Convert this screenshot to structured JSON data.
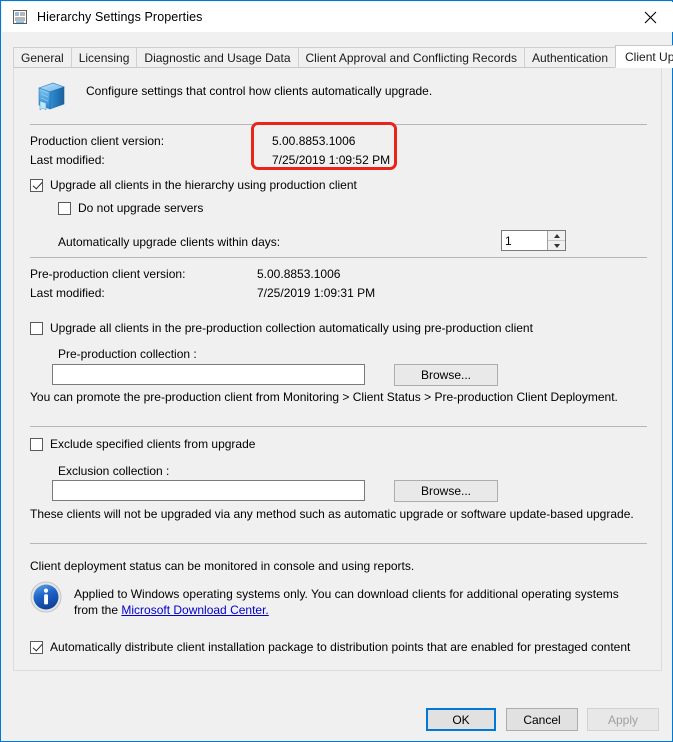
{
  "window": {
    "title": "Hierarchy Settings Properties",
    "title_icon": "properties-window-icon",
    "close_icon": "close-icon",
    "border_color": "#0078d7"
  },
  "tabs": [
    {
      "label": "General",
      "selected": false
    },
    {
      "label": "Licensing",
      "selected": false
    },
    {
      "label": "Diagnostic and Usage Data",
      "selected": false
    },
    {
      "label": "Client Approval and Conflicting Records",
      "selected": false
    },
    {
      "label": "Authentication",
      "selected": false
    },
    {
      "label": "Client Upgrade",
      "selected": true
    }
  ],
  "panel": {
    "header": {
      "icon": "client-package-3d-icon",
      "text": "Configure settings that control how clients automatically upgrade."
    },
    "production": {
      "version_label": "Production client version:",
      "version_value": "5.00.8853.1006",
      "modified_label": "Last modified:",
      "modified_value": "7/25/2019 1:09:52 PM",
      "upgrade_all_label": "Upgrade all clients in the hierarchy using production client",
      "upgrade_all_checked": true,
      "do_not_upgrade_servers_label": "Do not upgrade servers",
      "do_not_upgrade_servers_checked": false,
      "within_days_label": "Automatically upgrade clients within days:",
      "within_days_value": "1"
    },
    "preproduction": {
      "version_label": "Pre-production client version:",
      "version_value": "5.00.8853.1006",
      "modified_label": "Last modified:",
      "modified_value": "7/25/2019 1:09:31 PM",
      "upgrade_all_label": "Upgrade all clients in the pre-production collection automatically using pre-production client",
      "upgrade_all_checked": false,
      "collection_label": "Pre-production collection :",
      "collection_value": "",
      "collection_placeholder": "",
      "browse_label": "Browse...",
      "hint": "You can promote the pre-production client from Monitoring > Client Status > Pre-production Client Deployment."
    },
    "exclusion": {
      "exclude_label": "Exclude specified clients from upgrade",
      "exclude_checked": false,
      "collection_label": "Exclusion collection :",
      "collection_value": "",
      "collection_placeholder": "",
      "browse_label": "Browse...",
      "hint": "These clients will not be upgraded via any method such as automatic upgrade or software update-based upgrade."
    },
    "status": {
      "text": "Client deployment status can be monitored in console and using reports.",
      "info_icon": "info-icon",
      "info_text_before": "Applied to Windows operating systems only. You can download clients for additional operating systems from the ",
      "info_link": "Microsoft Download Center.",
      "auto_distribute_label": "Automatically distribute client installation package to distribution points that are enabled for prestaged content",
      "auto_distribute_checked": true
    }
  },
  "footer": {
    "ok_label": "OK",
    "cancel_label": "Cancel",
    "apply_label": "Apply",
    "apply_enabled": false
  },
  "annotation": {
    "color": "#e8241b",
    "shape": "rounded-rectangle",
    "targets": [
      "production.version_value",
      "production.modified_value"
    ]
  }
}
